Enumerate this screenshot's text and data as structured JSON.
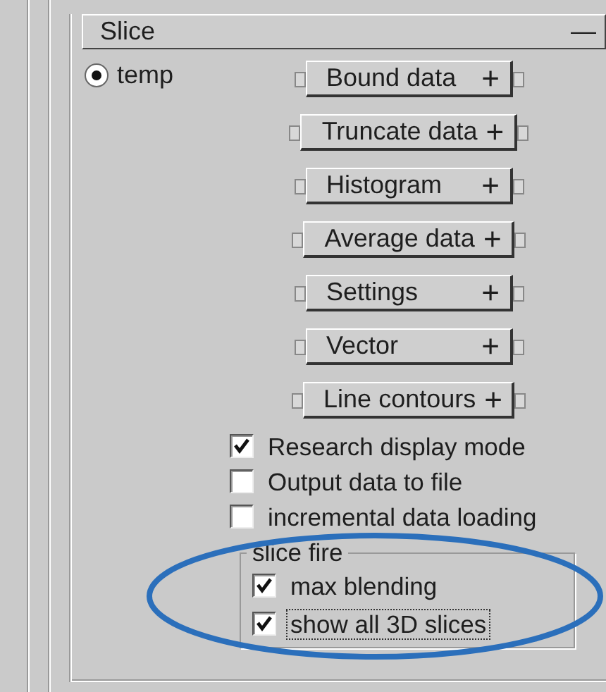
{
  "panel": {
    "title": "Slice",
    "collapse_glyph": "—"
  },
  "variable": {
    "label": "temp",
    "selected": true
  },
  "sections": [
    {
      "label": "Bound data",
      "toggle": "+"
    },
    {
      "label": "Truncate data",
      "toggle": "+"
    },
    {
      "label": "Histogram",
      "toggle": "+"
    },
    {
      "label": "Average data",
      "toggle": "+"
    },
    {
      "label": "Settings",
      "toggle": "+"
    },
    {
      "label": "Vector",
      "toggle": "+"
    },
    {
      "label": "Line contours",
      "toggle": "+"
    }
  ],
  "options": [
    {
      "label": "Research display mode",
      "checked": true
    },
    {
      "label": "Output data to file",
      "checked": false
    },
    {
      "label": "incremental data loading",
      "checked": false
    }
  ],
  "slice_fire": {
    "legend": "slice fire",
    "options": [
      {
        "label": "max blending",
        "checked": true,
        "focused": false
      },
      {
        "label": "show all 3D slices",
        "checked": true,
        "focused": true
      }
    ]
  },
  "annotation": {
    "kind": "ellipse"
  }
}
